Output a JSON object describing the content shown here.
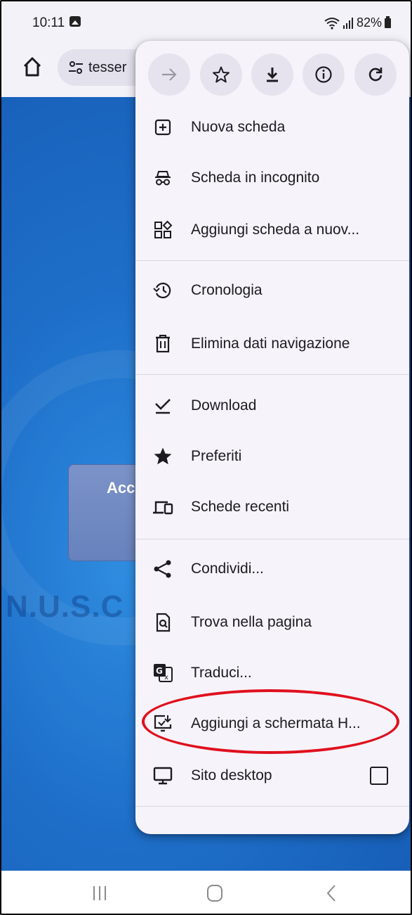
{
  "status_bar": {
    "time": "10:11",
    "battery": "82%"
  },
  "toolbar": {
    "url": "tesser"
  },
  "page": {
    "login_card_text": "Acc",
    "brand_text": "N.U.S.C"
  },
  "menu": {
    "actions": [
      {
        "name": "forward",
        "icon": "arrow-right-icon"
      },
      {
        "name": "bookmark",
        "icon": "star-outline-icon"
      },
      {
        "name": "download",
        "icon": "download-icon"
      },
      {
        "name": "page-info",
        "icon": "info-icon"
      },
      {
        "name": "reload",
        "icon": "reload-icon"
      }
    ],
    "items": [
      {
        "label": "Nuova scheda",
        "icon": "new-tab-icon"
      },
      {
        "label": "Scheda in incognito",
        "icon": "incognito-icon"
      },
      {
        "label": "Aggiungi scheda a nuov...",
        "icon": "tab-group-icon"
      },
      {
        "label": "Cronologia",
        "icon": "history-icon"
      },
      {
        "label": "Elimina dati navigazione",
        "icon": "trash-icon"
      },
      {
        "label": "Download",
        "icon": "download-check-icon"
      },
      {
        "label": "Preferiti",
        "icon": "star-icon"
      },
      {
        "label": "Schede recenti",
        "icon": "devices-icon"
      },
      {
        "label": "Condividi...",
        "icon": "share-icon"
      },
      {
        "label": "Trova nella pagina",
        "icon": "find-in-page-icon"
      },
      {
        "label": "Traduci...",
        "icon": "translate-icon"
      },
      {
        "label": "Aggiungi a schermata H...",
        "icon": "add-to-home-screen-icon"
      },
      {
        "label": "Sito desktop",
        "icon": "desktop-icon"
      }
    ]
  },
  "colors": {
    "highlight": "#e0101e",
    "page_blue": "#1e6fc9",
    "menu_bg": "#f6f3fb"
  }
}
